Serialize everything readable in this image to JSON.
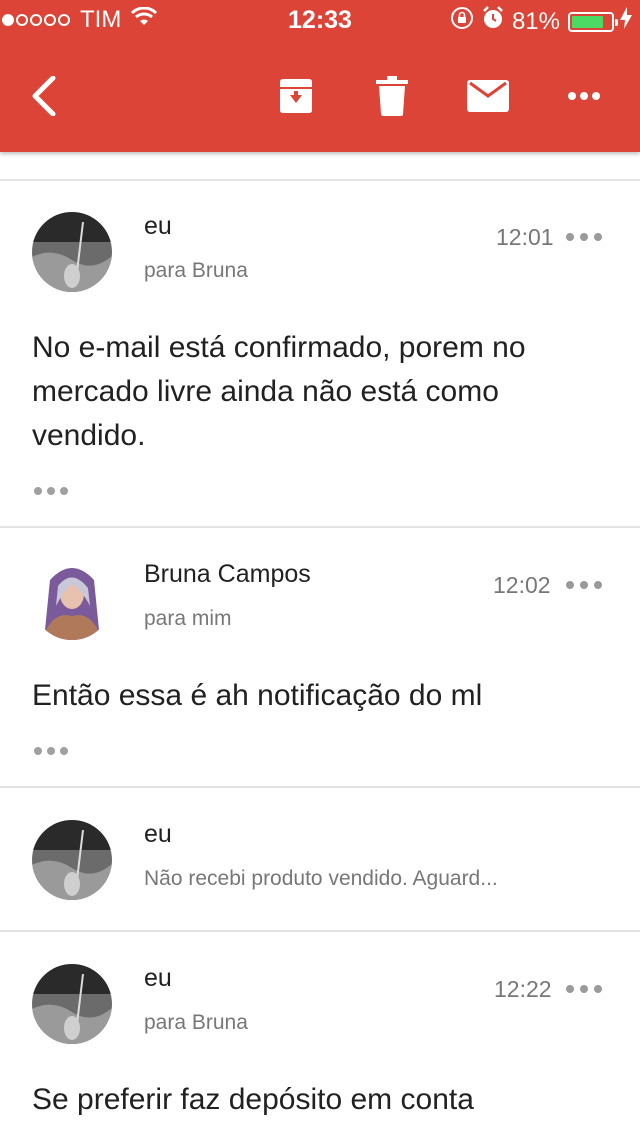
{
  "status_bar": {
    "signal_dots": 5,
    "signal_filled": 1,
    "carrier": "TIM",
    "time": "12:33",
    "battery_percent": "81%",
    "battery_level": 0.81,
    "icons": [
      "wifi-icon",
      "orientation-lock-icon",
      "alarm-icon",
      "charging-icon"
    ]
  },
  "toolbar": {
    "background": "#db4437",
    "icons": [
      "back-icon",
      "archive-icon",
      "trash-icon",
      "mail-icon",
      "more-icon"
    ]
  },
  "messages": [
    {
      "sender": "eu",
      "recipient": "para Bruna",
      "time": "12:01",
      "body": "No e-mail está confirmado, porem no mercado livre ainda não está como vendido."
    },
    {
      "sender": "Bruna Campos",
      "recipient": "para mim",
      "time": "12:02",
      "body": "Então essa é ah notificação do ml"
    },
    {
      "sender": "eu",
      "snippet": "Não recebi produto vendido. Aguard..."
    },
    {
      "sender": "eu",
      "recipient": "para Bruna",
      "time": "12:22",
      "body": "Se preferir faz depósito em conta"
    }
  ]
}
